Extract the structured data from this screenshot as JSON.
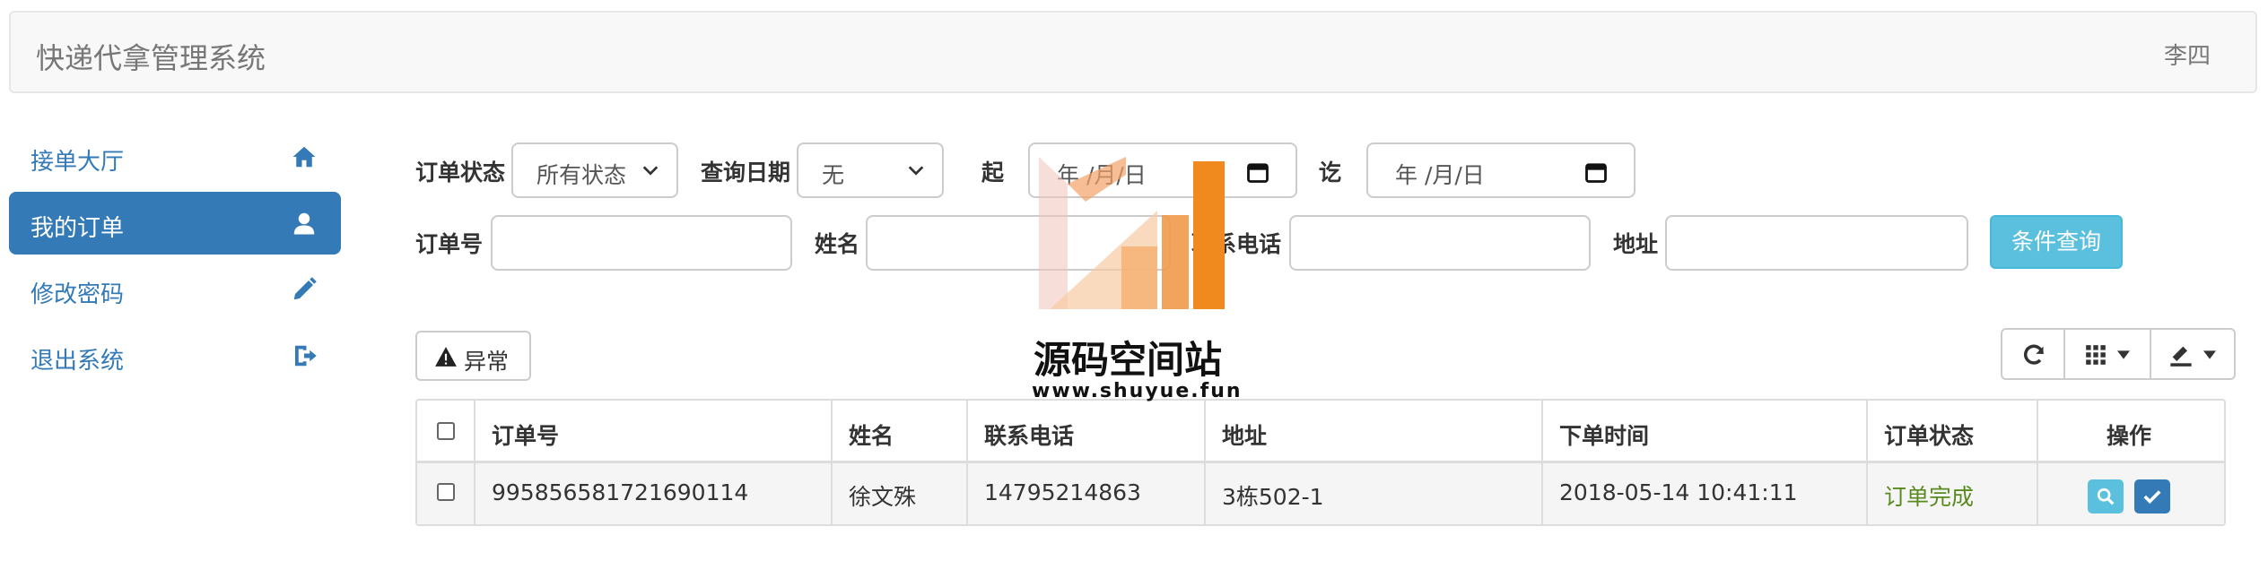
{
  "header": {
    "brand": "快递代拿管理系统",
    "user": "李四"
  },
  "sidebar": {
    "items": [
      {
        "label": "接单大厅",
        "icon": "home-icon",
        "active": false
      },
      {
        "label": "我的订单",
        "icon": "user-icon",
        "active": true
      },
      {
        "label": "修改密码",
        "icon": "pencil-icon",
        "active": false
      },
      {
        "label": "退出系统",
        "icon": "logout-icon",
        "active": false
      }
    ]
  },
  "filters": {
    "status_label": "订单状态",
    "status_value": "所有状态",
    "date_label": "查询日期",
    "date_value": "无",
    "start_label": "起",
    "start_placeholder": "年 /月/日",
    "end_label": "讫",
    "end_placeholder": "年 /月/日",
    "order_no_label": "订单号",
    "name_label": "姓名",
    "phone_label": "联系电话",
    "address_label": "地址",
    "query_button": "条件查询"
  },
  "toolbar": {
    "abnormal_button": "异常",
    "refresh_icon": "refresh-icon",
    "columns_icon": "grid-icon",
    "export_icon": "export-icon"
  },
  "table": {
    "headers": [
      "订单号",
      "姓名",
      "联系电话",
      "地址",
      "下单时间",
      "订单状态",
      "操作"
    ],
    "rows": [
      {
        "order_no": "995856581721690114",
        "name": "徐文殊",
        "phone": "14795214863",
        "address": "3栋502-1",
        "time": "2018-05-14 10:41:11",
        "status": "订单完成"
      }
    ]
  },
  "watermark": {
    "title": "源码空间站",
    "url": "www.shuyue.fun"
  },
  "colors": {
    "primary": "#337ab7",
    "info": "#5bc0de",
    "success_text": "#5a8a1f"
  }
}
